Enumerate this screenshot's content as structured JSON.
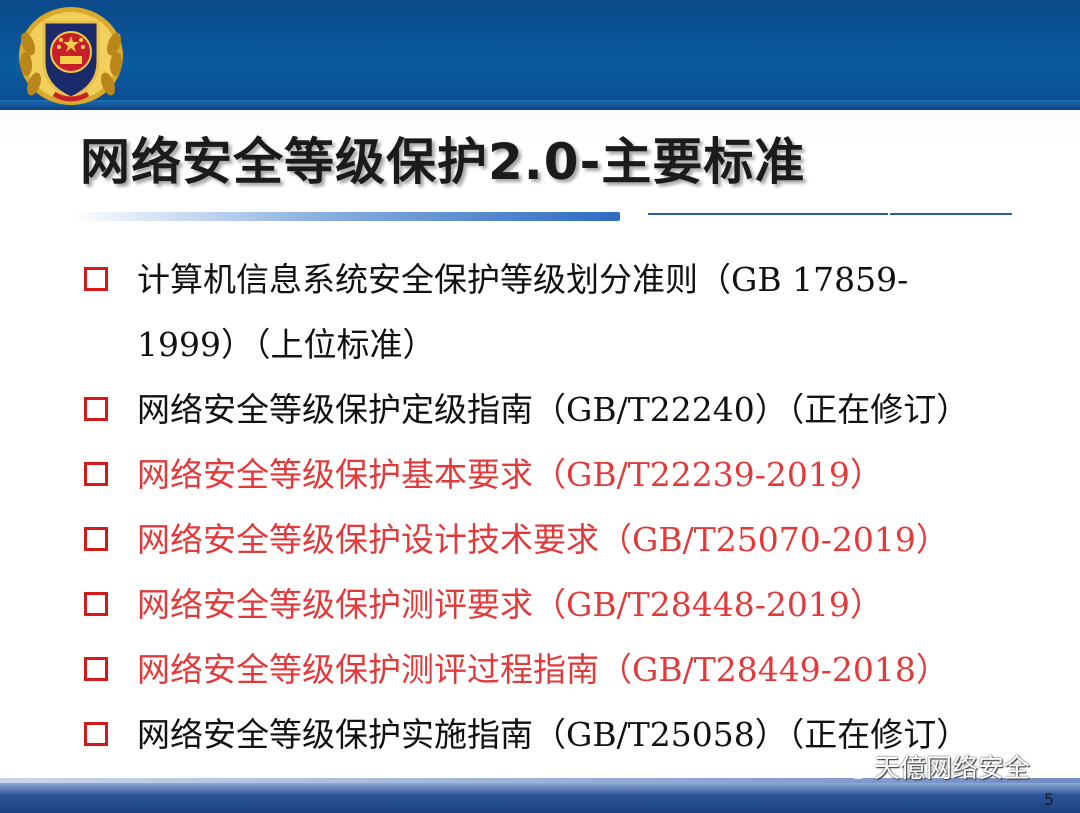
{
  "slide": {
    "title": "网络安全等级保护2.0-主要标准",
    "page_number": "5",
    "watermark": "天億网络安全",
    "colors": {
      "header": "#0a5aa0",
      "red_text": "#e23a3a",
      "bullet": "#d21a1a"
    }
  },
  "items": [
    {
      "line1": "计算机信息系统安全保护等级划分准则（GB 17859-",
      "line2": "1999）（上位标准）",
      "color": "black"
    },
    {
      "line1": "网络安全等级保护定级指南（GB/T22240）（正在修订）",
      "color": "black"
    },
    {
      "line1": "网络安全等级保护基本要求（GB/T22239-2019）",
      "color": "red"
    },
    {
      "line1": "网络安全等级保护设计技术要求（GB/T25070-2019）",
      "color": "red"
    },
    {
      "line1": "网络安全等级保护测评要求（GB/T28448-2019）",
      "color": "red"
    },
    {
      "line1": "网络安全等级保护测评过程指南（GB/T28449-2018）",
      "color": "red"
    },
    {
      "line1": "网络安全等级保护实施指南（GB/T25058）（正在修订）",
      "color": "black"
    }
  ]
}
